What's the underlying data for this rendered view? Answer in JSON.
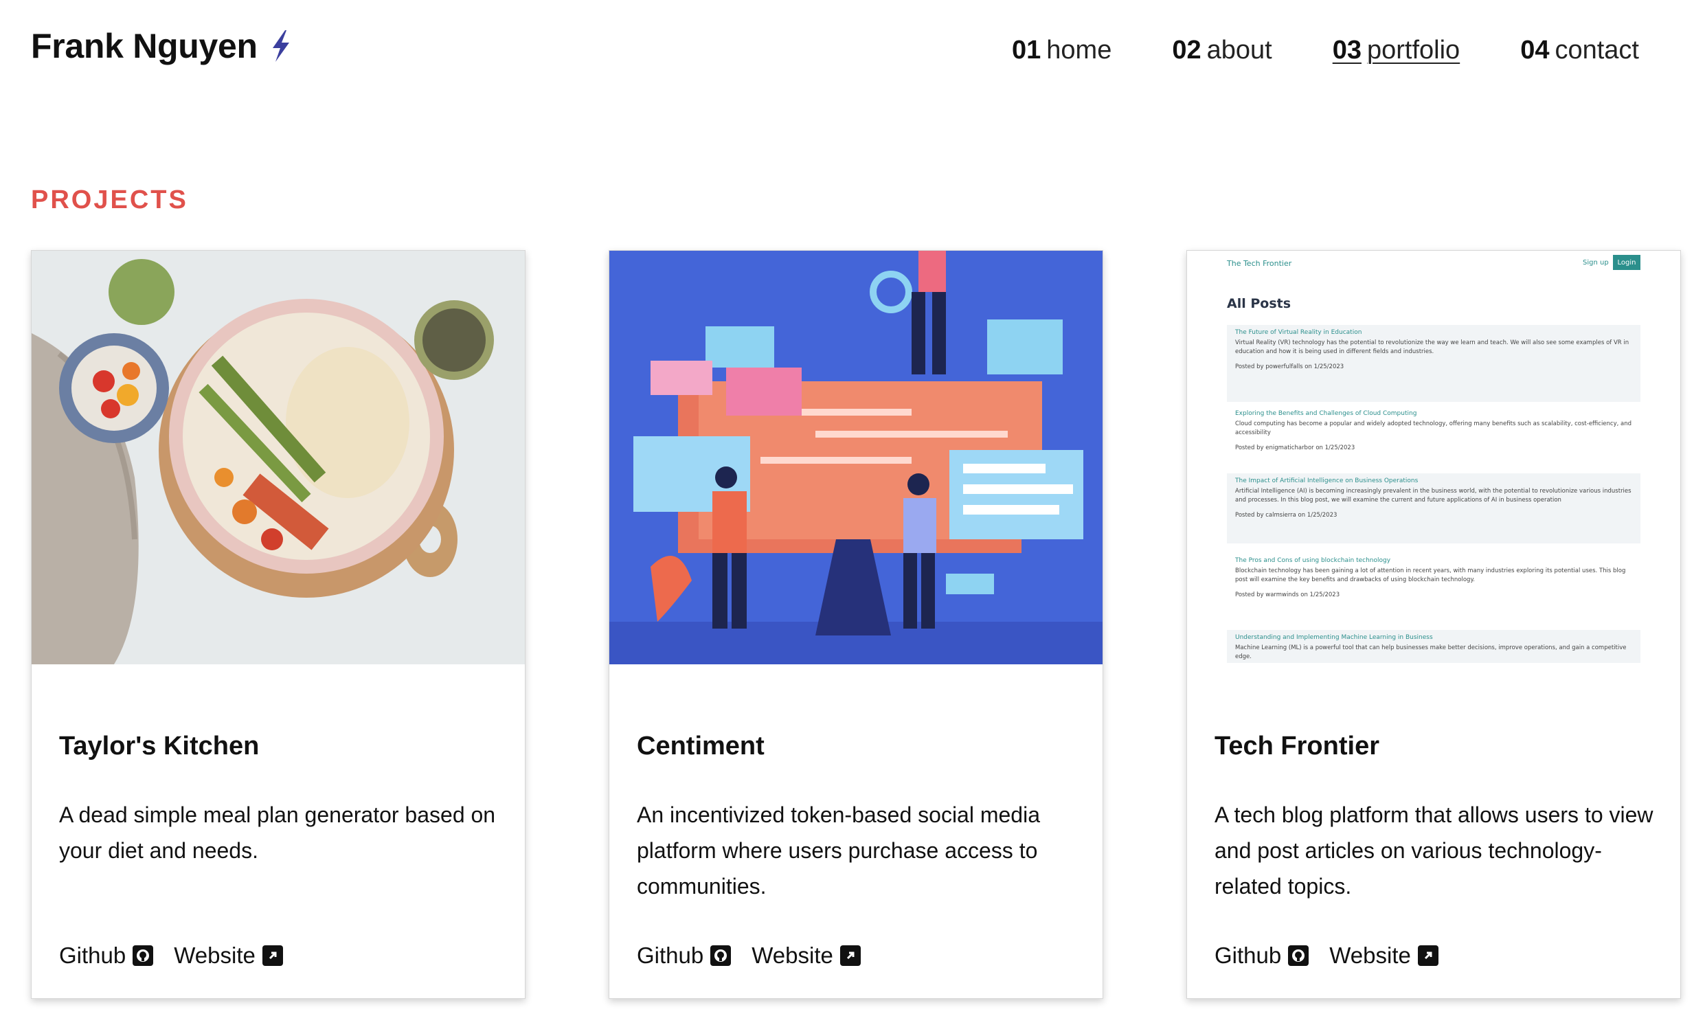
{
  "header": {
    "brand": "Frank Nguyen",
    "brand_icon": "lightning-bolt-icon",
    "nav": [
      {
        "num": "01",
        "label": "home"
      },
      {
        "num": "02",
        "label": "about"
      },
      {
        "num": "03",
        "label": "portfolio"
      },
      {
        "num": "04",
        "label": "contact"
      }
    ]
  },
  "section_title": "PROJECTS",
  "colors": {
    "accent": "#e0514b",
    "bolt": "#3b3f9e",
    "teal": "#2b8f8c"
  },
  "projects": [
    {
      "title": "Taylor's Kitchen",
      "description": "A dead simple meal plan generator based on your diet and needs.",
      "github_label": "Github",
      "website_label": "Website"
    },
    {
      "title": "Centiment",
      "description": "An incentivized token-based social media platform where users purchase access to communities.",
      "github_label": "Github",
      "website_label": "Website"
    },
    {
      "title": "Tech Frontier",
      "description": "A tech blog platform that allows users to view and post articles on various technology-related topics.",
      "github_label": "Github",
      "website_label": "Website"
    }
  ],
  "blog_preview": {
    "site_name": "The Tech Frontier",
    "signup": "Sign up",
    "login": "Login",
    "heading": "All Posts",
    "posts": [
      {
        "title": "The Future of Virtual Reality in Education",
        "body": "Virtual Reality (VR) technology has the potential to revolutionize the way we learn and teach. We will also see some examples of VR in education and how it is being used in different fields and industries.",
        "meta": "Posted by powerfulfalls on 1/25/2023"
      },
      {
        "title": "Exploring the Benefits and Challenges of Cloud Computing",
        "body": "Cloud computing has become a popular and widely adopted technology, offering many benefits such as scalability, cost-efficiency, and accessibility",
        "meta": "Posted by enigmaticharbor on 1/25/2023"
      },
      {
        "title": "The Impact of Artificial Intelligence on Business Operations",
        "body": "Artificial Intelligence (AI) is becoming increasingly prevalent in the business world, with the potential to revolutionize various industries and processes. In this blog post, we will examine the current and future applications of AI in business operation",
        "meta": "Posted by calmsierra on 1/25/2023"
      },
      {
        "title": "The Pros and Cons of using blockchain technology",
        "body": "Blockchain technology has been gaining a lot of attention in recent years, with many industries exploring its potential uses. This blog post will examine the key benefits and drawbacks of using blockchain technology.",
        "meta": "Posted by warmwinds on 1/25/2023"
      },
      {
        "title": "Understanding and Implementing Machine Learning in Business",
        "body": "Machine Learning (ML) is a powerful tool that can help businesses make better decisions, improve operations, and gain a competitive edge.",
        "meta": ""
      }
    ]
  }
}
